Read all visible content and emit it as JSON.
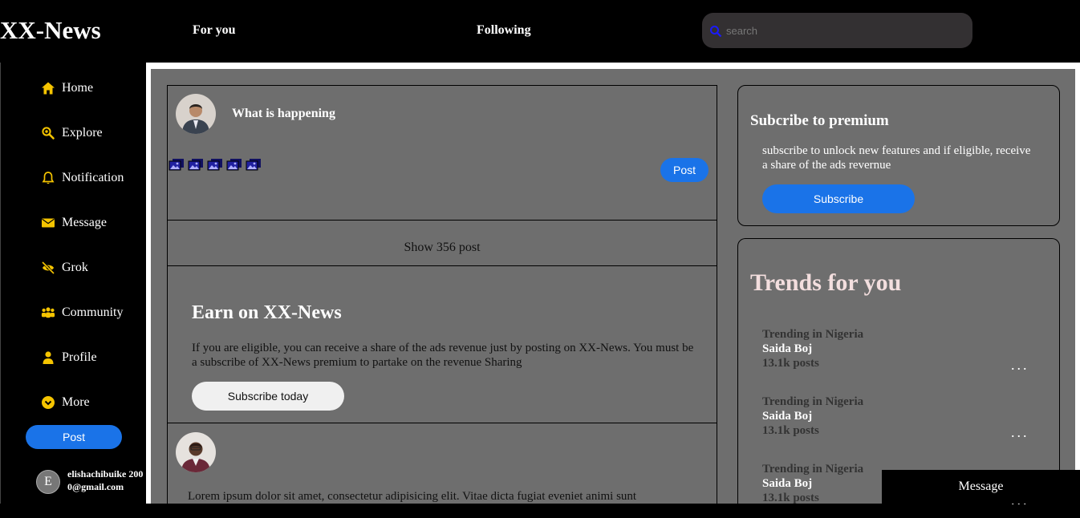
{
  "header": {
    "logo": "XX-News",
    "tabs": [
      {
        "label": "For you"
      },
      {
        "label": "Following"
      }
    ],
    "search": {
      "placeholder": "search",
      "icon": "search-icon"
    }
  },
  "sidebar": {
    "items": [
      {
        "label": "Home",
        "icon": "home-icon"
      },
      {
        "label": "Explore",
        "icon": "search-icon"
      },
      {
        "label": "Notification",
        "icon": "bell-icon"
      },
      {
        "label": "Message",
        "icon": "envelope-icon"
      },
      {
        "label": "Grok",
        "icon": "grok-icon"
      },
      {
        "label": "Community",
        "icon": "community-icon"
      },
      {
        "label": "Profile",
        "icon": "user-icon"
      },
      {
        "label": "More",
        "icon": "chevron-down-icon"
      }
    ],
    "post_label": "Post",
    "user": {
      "initial": "E",
      "email": "elishachibuike 2000@gmail.com"
    }
  },
  "composer": {
    "title": "What is happening",
    "post_label": "Post",
    "media_icons": [
      "image-icon",
      "image-icon",
      "image-icon",
      "image-icon",
      "image-icon"
    ]
  },
  "feed": {
    "show_posts": "Show 356 post",
    "earn": {
      "title": "Earn on XX-News",
      "text": "If you are eligible, you can receive a share of the ads revenue just by posting on XX-News. You must be a subscribe of XX-News premium to partake on the revenue Sharing",
      "button": "Subscribe today"
    },
    "post2": {
      "text": "Lorem ipsum dolor sit amet, consectetur adipisicing elit. Vitae dicta fugiat eveniet animi sunt"
    }
  },
  "premium": {
    "title": "Subcribe to premium",
    "text": "subscribe to unlock new features and if eligible, receive a share of the ads revernue",
    "button": "Subscribe"
  },
  "trends": {
    "title": "Trends for you",
    "items": [
      {
        "category": "Trending in Nigeria",
        "name": "Saida Boj",
        "count": "13.1k posts",
        "more": "..."
      },
      {
        "category": "Trending in Nigeria",
        "name": "Saida Boj",
        "count": "13.1k posts",
        "more": "..."
      },
      {
        "category": "Trending in Nigeria",
        "name": "Saida Boj",
        "count": "13.1k posts",
        "more": "..."
      }
    ]
  },
  "message_bar": {
    "label": "Message"
  },
  "colors": {
    "accent": "#1a73e8",
    "icon": "#f5c400",
    "panel": "#6e6e6e"
  }
}
